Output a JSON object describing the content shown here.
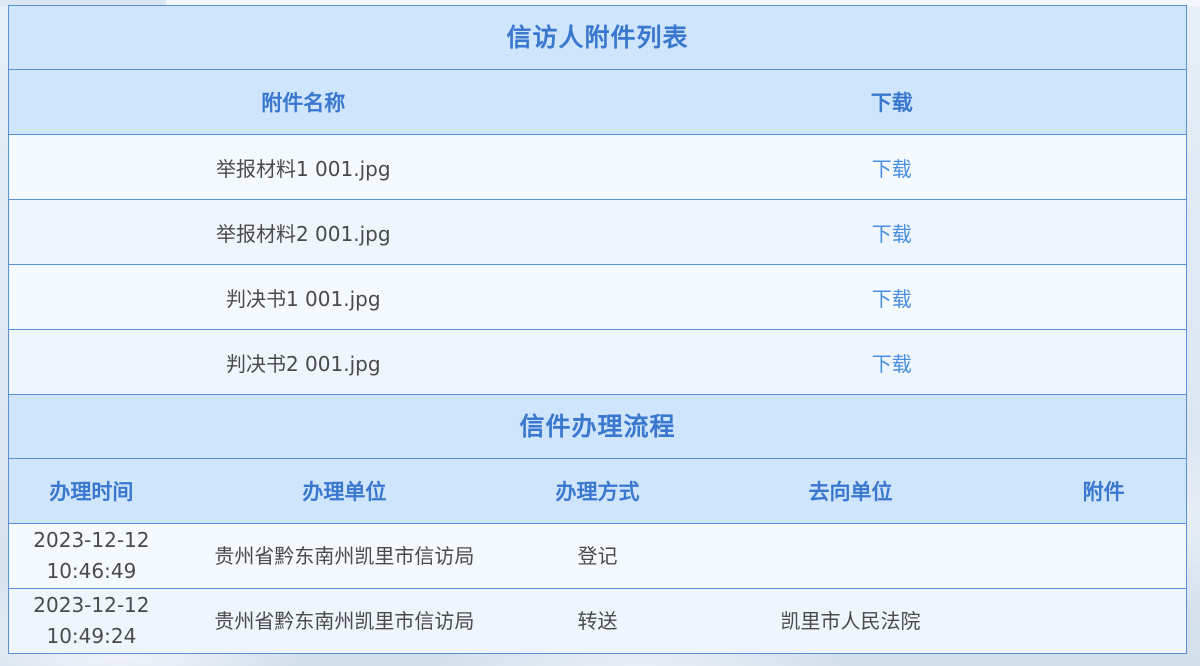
{
  "attachments": {
    "title": "信访人附件列表",
    "headers": {
      "name": "附件名称",
      "download": "下载"
    },
    "rows": [
      {
        "name": "举报材料1 001.jpg",
        "download": "下载"
      },
      {
        "name": "举报材料2 001.jpg",
        "download": "下载"
      },
      {
        "name": "判决书1 001.jpg",
        "download": "下载"
      },
      {
        "name": "判决书2 001.jpg",
        "download": "下载"
      }
    ]
  },
  "process": {
    "title": "信件办理流程",
    "headers": {
      "time": "办理时间",
      "unit": "办理单位",
      "method": "办理方式",
      "destination": "去向单位",
      "attachment": "附件"
    },
    "rows": [
      {
        "date": "2023-12-12",
        "clock": "10:46:49",
        "unit": "贵州省黔东南州凯里市信访局",
        "method": "登记",
        "destination": "",
        "attachment": ""
      },
      {
        "date": "2023-12-12",
        "clock": "10:49:24",
        "unit": "贵州省黔东南州凯里市信访局",
        "method": "转送",
        "destination": "凯里市人民法院",
        "attachment": ""
      }
    ]
  },
  "colors": {
    "header_bg": "#cfe5fb",
    "header_text": "#3a78cf",
    "border": "#5b8fd6",
    "link": "#4a8fe0"
  }
}
